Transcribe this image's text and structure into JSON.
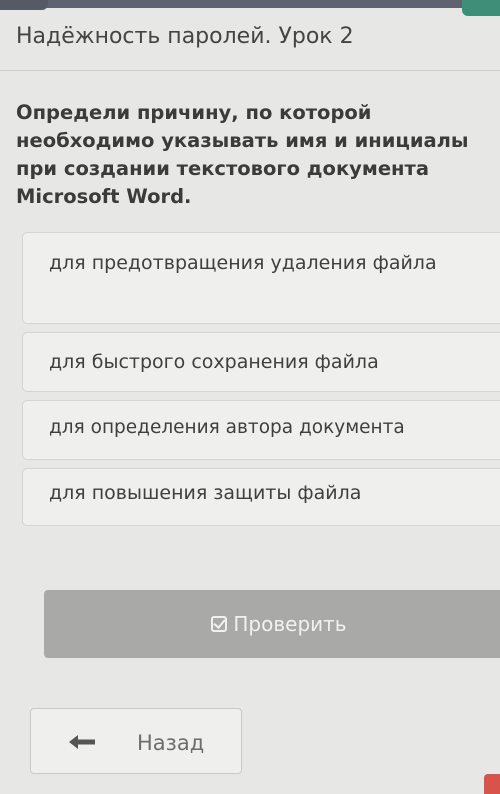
{
  "lesson": {
    "title": "Надёжность паролей. Урок 2"
  },
  "question": {
    "text": "Определи причину, по которой необходимо указывать имя и инициалы при создании текстового документа Microsoft Word."
  },
  "answers": [
    {
      "label": "для предотвращения удаления файла"
    },
    {
      "label": "для быстрого сохранения файла"
    },
    {
      "label": "для определения автора документа"
    },
    {
      "label": "для повышения защиты файла"
    }
  ],
  "check_button": {
    "label": "Проверить",
    "icon": "check-square-icon"
  },
  "back_button": {
    "label": "Назад",
    "icon": "arrow-left-icon"
  },
  "colors": {
    "background": "#e7e7e5",
    "check_button": "#a9a9a7",
    "accent_green": "#3f8f78"
  }
}
